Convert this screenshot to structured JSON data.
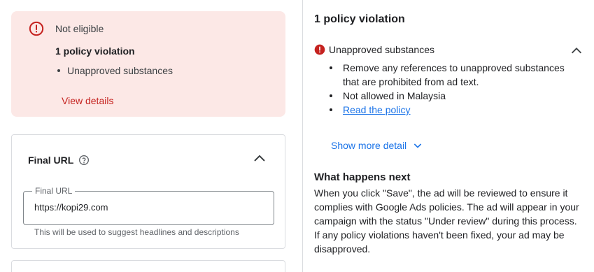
{
  "alert": {
    "status": "Not eligible",
    "title": "1 policy violation",
    "items": [
      "Unapproved substances"
    ],
    "link": "View details"
  },
  "final_url_card": {
    "title": "Final URL",
    "field_label": "Final URL",
    "field_value": "https://kopi29.com",
    "hint": "This will be used to suggest headlines and descriptions"
  },
  "policy_panel": {
    "title": "1 policy violation",
    "issue": "Unapproved substances",
    "bullets": [
      "Remove any references to unapproved substances that are prohibited from ad text.",
      "Not allowed in Malaysia"
    ],
    "policy_link": "Read the policy",
    "show_more": "Show more detail",
    "next_title": "What happens next",
    "next_body": "When you click \"Save\", the ad will be reviewed to ensure it complies with Google Ads policies. The ad will appear in your campaign with the status \"Under review\" during this process. If any policy violations haven't been fixed, your ad may be disapproved."
  },
  "colors": {
    "alert_bg": "#fce8e6",
    "error_red": "#c5221f",
    "link_blue": "#1a73e8",
    "border": "#dadce0"
  },
  "icons": {
    "alert": "error-outline-icon",
    "help": "help-outline-icon",
    "expand": "chevron-up-icon",
    "issue": "error-filled-icon",
    "show_more": "chevron-down-icon"
  }
}
